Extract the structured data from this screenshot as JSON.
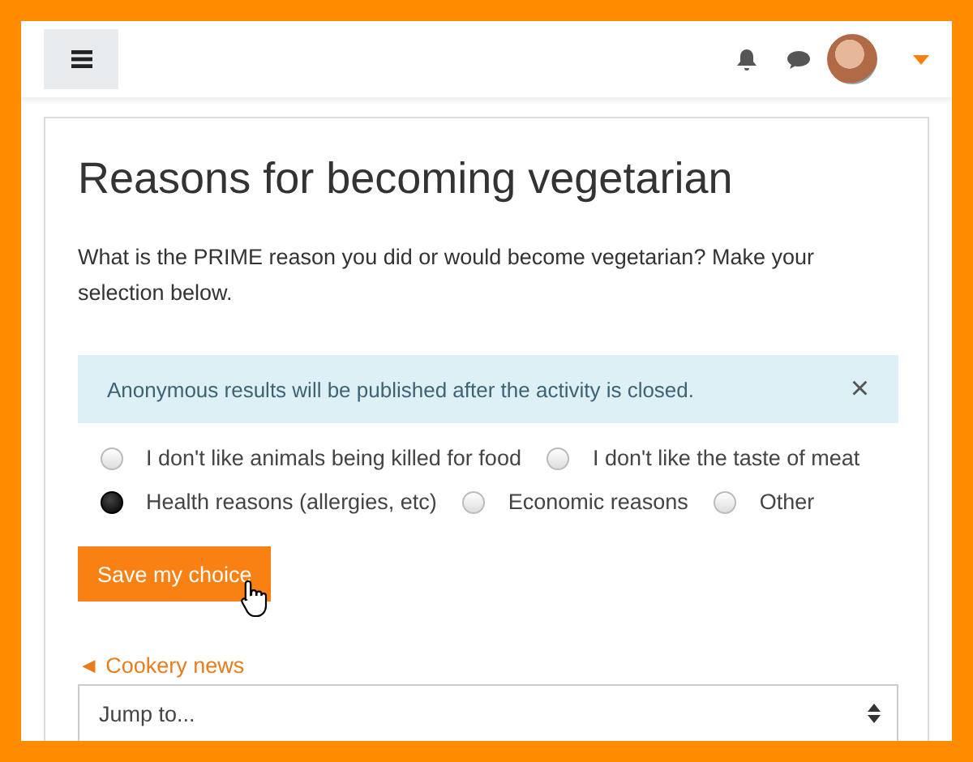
{
  "activity": {
    "title": "Reasons for becoming vegetarian",
    "intro": "What is the PRIME reason you did or would become vegetarian? Make your selection below.",
    "alert": {
      "text": "Anonymous results will be published after the activity is closed.",
      "close": "×"
    },
    "options": [
      {
        "label": "I don't like animals being killed for food",
        "selected": false
      },
      {
        "label": "I don't like the taste of meat",
        "selected": false
      },
      {
        "label": "Health reasons (allergies, etc)",
        "selected": true
      },
      {
        "label": "Economic reasons",
        "selected": false
      },
      {
        "label": "Other",
        "selected": false
      }
    ],
    "save_button": "Save my choice",
    "prev_link": "◄ Cookery news",
    "jump_select": {
      "value": "Jump to..."
    }
  }
}
